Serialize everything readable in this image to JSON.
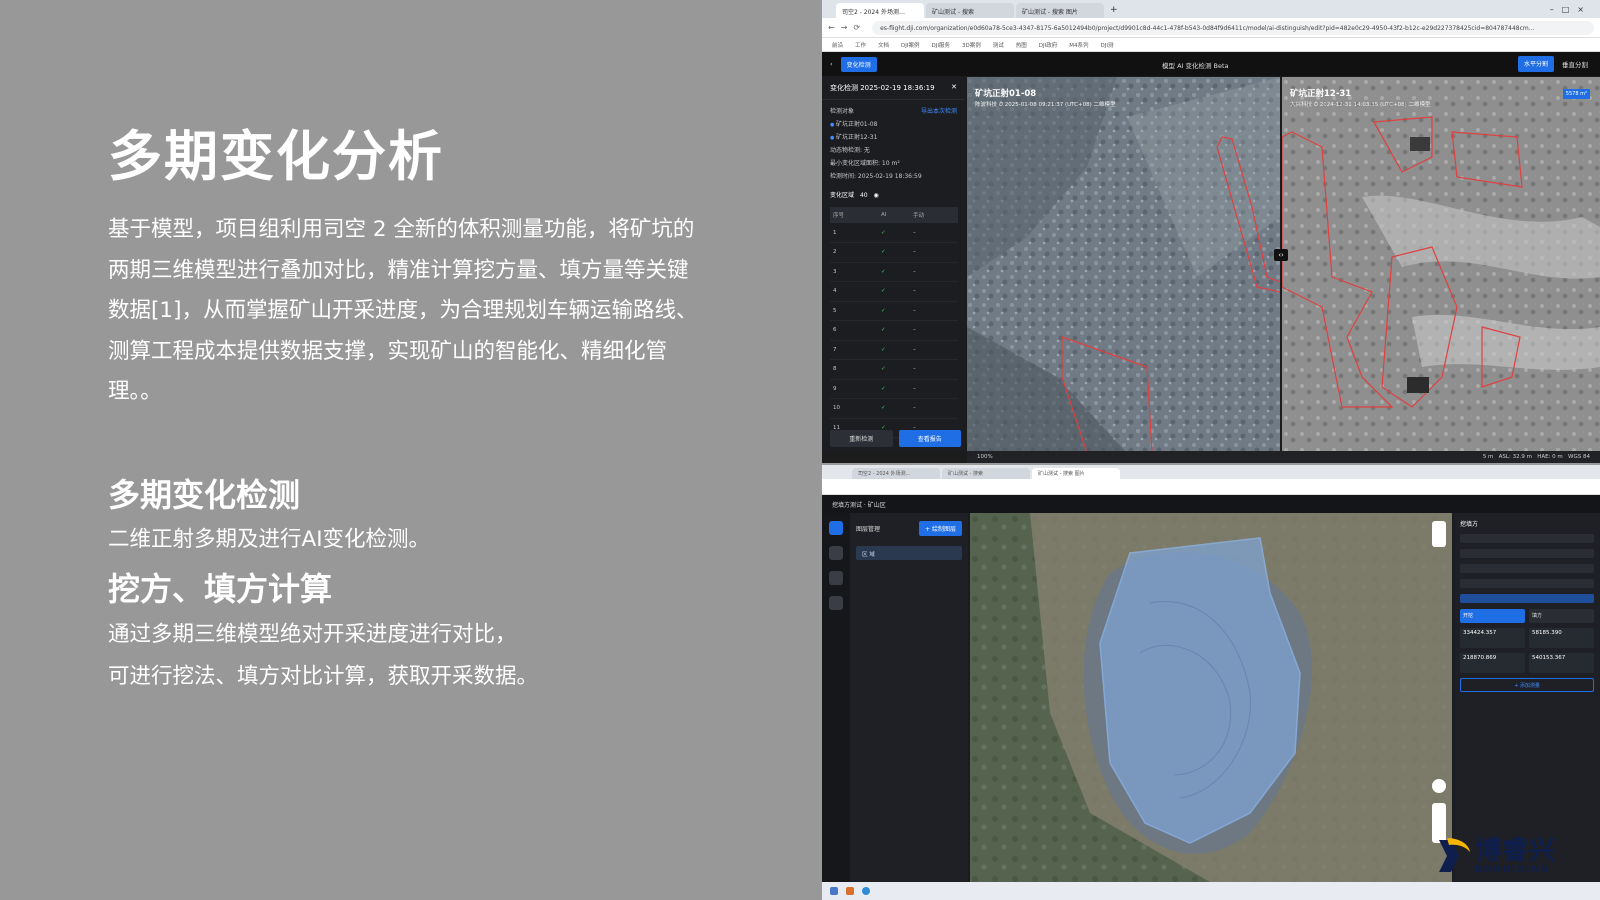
{
  "slide": {
    "title": "多期变化分析",
    "paragraph": "基于模型，项目组利用司空 2 全新的体积测量功能，将矿坑的两期三维模型进行叠加对比，精准计算挖方量、填方量等关键数据[1]，从而掌握矿山开采进度，为合理规划车辆运输路线、测算工程成本提供数据支撑，实现矿山的智能化、精细化管理。。",
    "section1_title": "多期变化检测",
    "section1_text": "二维正射多期及进行AI变化检测。",
    "section2_title": "挖方、填方计算",
    "section2_text_line1": "通过多期三维模型绝对开采进度进行对比，",
    "section2_text_line2": "可进行挖法、填方对比计算，获取开采数据。"
  },
  "browser1": {
    "tabs": [
      "司空2 - 2024 外场测…",
      "矿山测试 - 搜索",
      "矿山测试 - 搜索 图片"
    ],
    "url": "es-flight.dji.com/organization/e0d60a78-5ce3-4347-8175-6a5012494b0/project/d9901c8d-44c1-478f-b543-0d84f9d6411c/model/ai-distinguish/edit?pid=482e0c29-4950-43f2-b12c-e29d227378425cid=804787448cm…",
    "bookmarks": [
      "前沿",
      "工作",
      "文档",
      "DJI案例",
      "DJI服务",
      "3D案例",
      "测试",
      "热图",
      "DJI政府",
      "M4系列",
      "DJI测"
    ]
  },
  "app1": {
    "mode_button": "变化检测",
    "center_title": "模型 AI 变化检测 Beta",
    "view_horizontal": "水平分割",
    "view_split": "垂直分割",
    "panel_title": "变化检测 2025-02-19 18:36:19",
    "detect_objects_label": "检测对象",
    "detect_link": "导出本次检测",
    "object_a": "矿坑正射01-08",
    "object_b": "矿坑正射12-31",
    "detect_type": "动态物检测: 无",
    "min_area": "最小变化区域面积: 10 m²",
    "detect_time": "检测时间: 2025-02-19 18:36:59",
    "change_count_label": "变化区域",
    "change_count": "40",
    "table_headers": [
      "序号",
      "AI",
      "手动"
    ],
    "rows": [
      "1",
      "2",
      "3",
      "4",
      "5",
      "6",
      "7",
      "8",
      "9",
      "10",
      "11"
    ],
    "check": "✓",
    "dash": "–",
    "btn_redetect": "重新检测",
    "btn_report": "查看报告",
    "left_map_title": "矿坑正射01-08",
    "left_map_meta": "陈波科技   ⏱ 2025-01-08 09:21:37 (UTC+08)   二维模型",
    "right_map_title": "矿坑正射12-31",
    "right_map_meta": "大兴科技   ⏱ 2024-12-31 14:03:35 (UTC+08)   二维模型",
    "area_badge": "5578 m²",
    "zoom_level": "100%",
    "scale_label": "5 m",
    "alt_label": "ASL: 32.9 m",
    "hae_label": "HAE: 0 m",
    "crs_label": "WGS 84"
  },
  "app2": {
    "tabs": [
      "司空2 - 2024 外场测…",
      "矿山测试 - 搜索",
      "矿山测试 - 搜索 图片"
    ],
    "header": "挖填方测试 · 矿山区",
    "panel_title": "图层管理",
    "panel_button": "+ 绘制图层",
    "layer_item": "区 域",
    "rp_title": "挖填方",
    "rp_tab_a": "开挖",
    "rp_tab_b": "填方",
    "result_a": "334424.357",
    "result_b": "58185.390",
    "result_c": "218870.869",
    "result_d": "540153.367",
    "bottom_btn": "+ 添加测量"
  },
  "logo": {
    "cn": "博睿兴",
    "en": "BORUIXING"
  },
  "colors": {
    "slide_bg": "#989898",
    "accent_blue": "#1f6ee6",
    "change_red": "#e0403f",
    "logo_navy": "#0f1f4d",
    "logo_yellow": "#f5b400"
  }
}
